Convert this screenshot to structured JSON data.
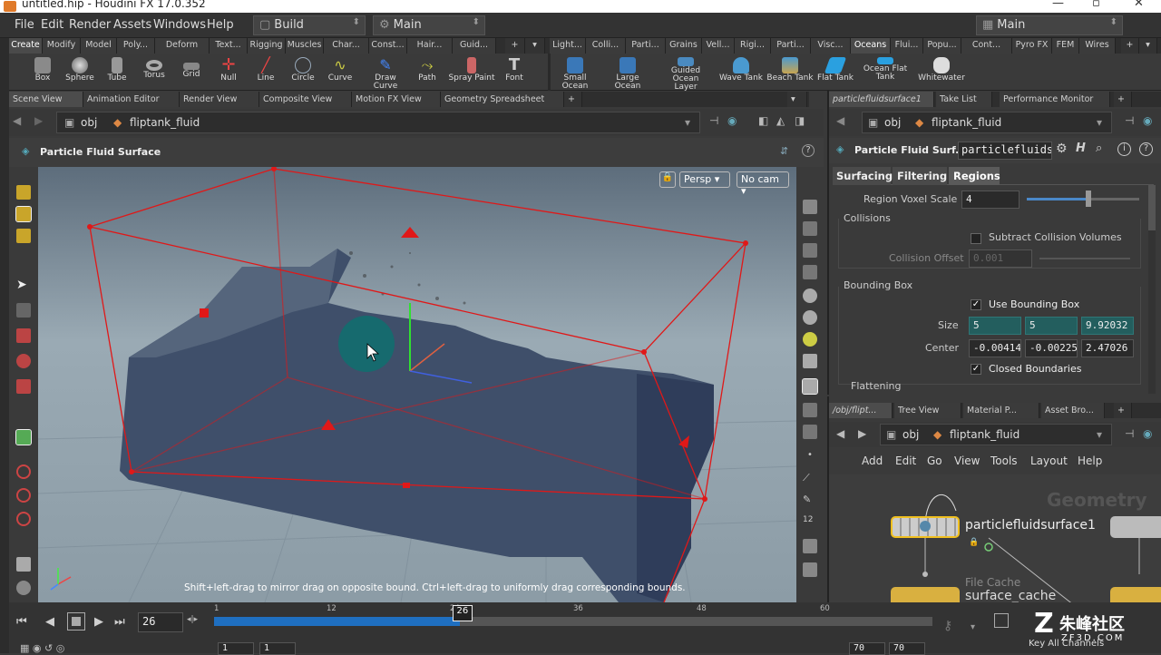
{
  "window": {
    "title": "untitled.hip - Houdini FX 17.0.352"
  },
  "menu": {
    "items": [
      "File",
      "Edit",
      "Render",
      "Assets",
      "Windows",
      "Help"
    ],
    "desktop": "Build",
    "desktop_right": "Main",
    "main_tab": "Main"
  },
  "shelf": {
    "left_tabs": [
      "Create",
      "Modify",
      "Model",
      "Poly...",
      "Deform",
      "Text...",
      "Rigging",
      "Muscles",
      "Char...",
      "Const...",
      "Hair...",
      "Guid..."
    ],
    "right_tabs": [
      "Light...",
      "Colli...",
      "Parti...",
      "Grains",
      "Vell...",
      "Rigi...",
      "Parti...",
      "Visc...",
      "Oceans",
      "Flui...",
      "Popu...",
      "Cont...",
      "Pyro FX",
      "FEM",
      "Wires"
    ],
    "left_tools": [
      "Box",
      "Sphere",
      "Tube",
      "Torus",
      "Grid",
      "Null",
      "Line",
      "Circle",
      "Curve",
      "Draw Curve",
      "Path",
      "Spray Paint",
      "Font"
    ],
    "right_tools": [
      "Small Ocean",
      "Large Ocean",
      "Guided Ocean Layer",
      "Wave Tank",
      "Beach Tank",
      "Flat Tank",
      "Ocean Flat Tank",
      "Whitewater"
    ]
  },
  "viewer": {
    "tabs": [
      "Scene View",
      "Animation Editor",
      "Render View",
      "Composite View",
      "Motion FX View",
      "Geometry Spreadsheet"
    ],
    "path_root": "obj",
    "path_node": "fliptank_fluid",
    "node_title": "Particle Fluid Surface",
    "persp": "Persp",
    "cam": "No cam",
    "hint": "Shift+left-drag to mirror drag on opposite bound. Ctrl+left-drag to uniformly drag corresponding bounds."
  },
  "params": {
    "tabs_top": [
      "particlefluidsurface1",
      "Take List",
      "Performance Monitor"
    ],
    "path_root": "obj",
    "path_node": "fliptank_fluid",
    "node_type": "Particle Fluid Surf...",
    "node_name": "particlefluids",
    "sub_tabs": [
      "Surfacing",
      "Filtering",
      "Regions"
    ],
    "region_voxel_scale_label": "Region Voxel Scale",
    "region_voxel_scale": "4",
    "region_voxel_level": 0.55,
    "collisions_label": "Collisions",
    "subtract_label": "Subtract Collision Volumes",
    "collision_offset_label": "Collision Offset",
    "collision_offset": "0.001",
    "bbox_label": "Bounding Box",
    "use_bbox_label": "Use Bounding Box",
    "size_label": "Size",
    "size": [
      "5",
      "5",
      "9.92032"
    ],
    "center_label": "Center",
    "center": [
      "-0.00414",
      "-0.00225",
      "2.47026"
    ],
    "closed_label": "Closed Boundaries",
    "flattening_label": "Flattening"
  },
  "network": {
    "tabs": [
      "/obj/flipt...",
      "Tree View",
      "Material P...",
      "Asset Bro..."
    ],
    "path_root": "obj",
    "path_node": "fliptank_fluid",
    "menu": [
      "Add",
      "Edit",
      "Go",
      "View",
      "Tools",
      "Layout",
      "Help"
    ],
    "watermark": "Geometry",
    "node1": "particlefluidsurface1",
    "node2_type": "File Cache",
    "node2": "surface_cache"
  },
  "timeline": {
    "frame": "26",
    "ticks": [
      "1",
      "12",
      "24",
      "36",
      "48",
      "60"
    ],
    "current": "26",
    "start": "1",
    "start2": "1",
    "end": "70",
    "end2": "70",
    "progress": 0.45,
    "key_all": "Key All Channels"
  },
  "brand": {
    "cn": "朱峰社区",
    "url": "ZF3D.COM"
  }
}
